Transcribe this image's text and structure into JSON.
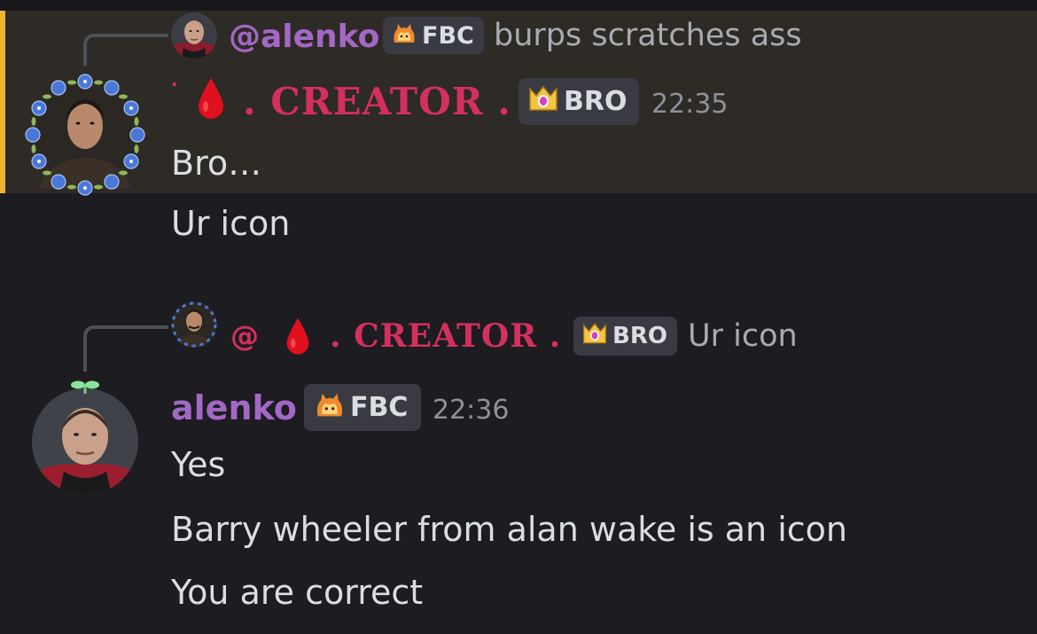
{
  "colors": {
    "background": "#1c1c21",
    "highlight_background": "#2e2a26",
    "highlight_bar": "#f0b232",
    "username_purple": "#a268c4",
    "creator_red": "#d4305d",
    "timestamp_gray": "#8f9199",
    "message_text": "#dbdee1"
  },
  "messages": [
    {
      "reply": {
        "mention": "@alenko",
        "tag": {
          "icon": "flame-cat-icon",
          "label": "FBC"
        },
        "preview": "burps scratches ass"
      },
      "author": {
        "prefix": ".",
        "icon": "blood-drop-icon",
        "name": ". CREATOR .",
        "tag": {
          "icon": "crown-gem-icon",
          "label": "BRO"
        }
      },
      "timestamp": "22:35",
      "lines": [
        "Bro…",
        "Ur icon"
      ]
    },
    {
      "reply": {
        "mention": "@",
        "icon": "blood-drop-icon",
        "name": ". CREATOR .",
        "tag": {
          "icon": "crown-gem-icon",
          "label": "BRO"
        },
        "preview": "Ur icon"
      },
      "author": {
        "name": "alenko",
        "tag": {
          "icon": "flame-cat-icon",
          "label": "FBC"
        }
      },
      "timestamp": "22:36",
      "lines": [
        "Yes",
        "Barry wheeler from alan wake is an icon",
        "You are correct"
      ]
    }
  ]
}
